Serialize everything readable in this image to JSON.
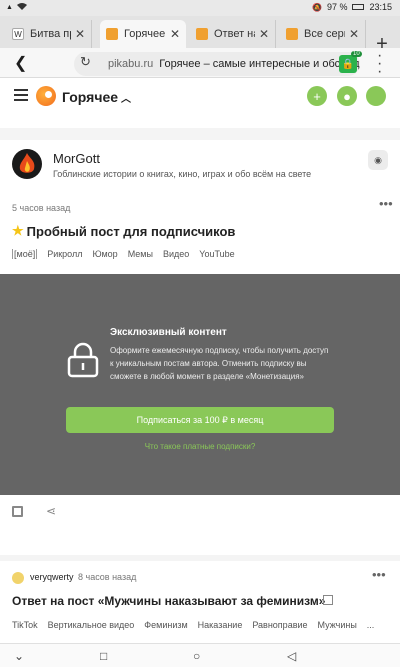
{
  "status": {
    "signal": "▲",
    "wifi": "wifi",
    "battery": "97 %",
    "time": "23:15",
    "mute": "🔕"
  },
  "tabs": [
    {
      "title": "Битва пр",
      "favicon": "W"
    },
    {
      "title": "Горячее –",
      "favicon": ""
    },
    {
      "title": "Ответ на",
      "favicon": ""
    },
    {
      "title": "Все сери",
      "favicon": ""
    }
  ],
  "urlbar": {
    "host": "pikabu.ru",
    "title": "Горячее – самые интересные и обсуждае",
    "ext_badge": "10"
  },
  "header": {
    "section": "Горячее"
  },
  "community": {
    "name": "MorGott",
    "description": "Гоблинские истории о книгах, кино, играх и обо всём на свете"
  },
  "post": {
    "time": "5 часов назад",
    "title": "Пробный пост для подписчиков",
    "tags": [
      "[моё]",
      "Рикролл",
      "Юмор",
      "Мемы",
      "Видео",
      "YouTube"
    ]
  },
  "paywall": {
    "title": "Эксклюзивный контент",
    "text": "Оформите ежемесячную подписку, чтобы получить доступ к уникальным постам автора. Отменить подписку вы сможете в любой момент в разделе «Монетизация»",
    "button": "Подписаться за 100 ₽ в месяц",
    "link": "Что такое платные подписки?"
  },
  "post2": {
    "user": "veryqwerty",
    "time": "8 часов назад",
    "title": "Ответ на пост «Мужчины наказывают за феминизм»",
    "tags": [
      "TikTok",
      "Вертикальное видео",
      "Феминизм",
      "Наказание",
      "Равноправие",
      "Мужчины",
      "..."
    ]
  },
  "colors": {
    "accent": "#8ac858",
    "paywall_bg": "#656565"
  }
}
